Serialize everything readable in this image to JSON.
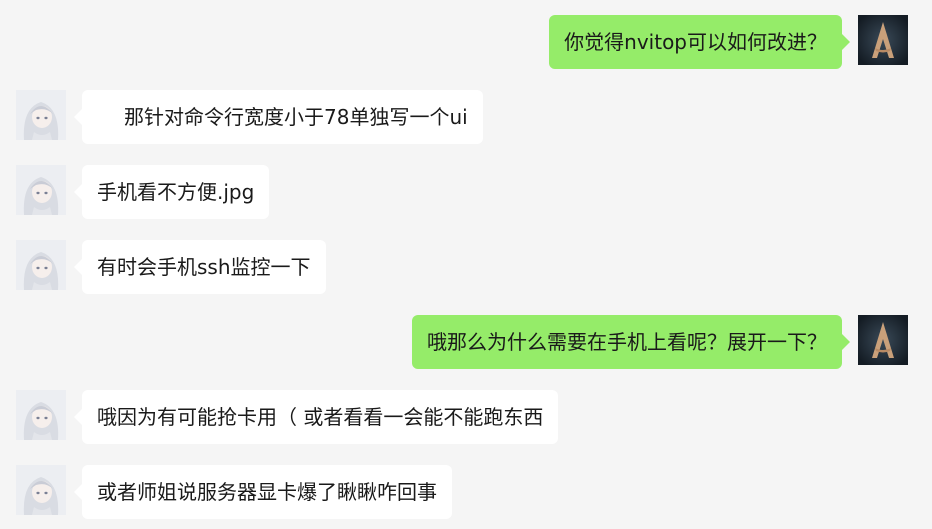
{
  "chat": {
    "messages": [
      {
        "side": "out",
        "avatar": "assassin-emblem-avatar",
        "text": "你觉得nvitop可以如何改进？"
      },
      {
        "side": "in",
        "avatar": "anime-girl-avatar",
        "text": "那针对命令行宽度小于78单独写一个ui"
      },
      {
        "side": "in",
        "avatar": "anime-girl-avatar",
        "text": "手机看不方便.jpg"
      },
      {
        "side": "in",
        "avatar": "anime-girl-avatar",
        "text": "有时会手机ssh监控一下"
      },
      {
        "side": "out",
        "avatar": "assassin-emblem-avatar",
        "text": "哦那么为什么需要在手机上看呢？展开一下？"
      },
      {
        "side": "in",
        "avatar": "anime-girl-avatar",
        "text": "哦因为有可能抢卡用（ 或者看看一会能不能跑东西"
      },
      {
        "side": "in",
        "avatar": "anime-girl-avatar",
        "text": "或者师姐说服务器显卡爆了瞅瞅咋回事"
      }
    ]
  },
  "colors": {
    "background": "#f5f5f5",
    "outgoing_bubble": "#95ec69",
    "incoming_bubble": "#ffffff",
    "text": "#1a1a1a"
  }
}
